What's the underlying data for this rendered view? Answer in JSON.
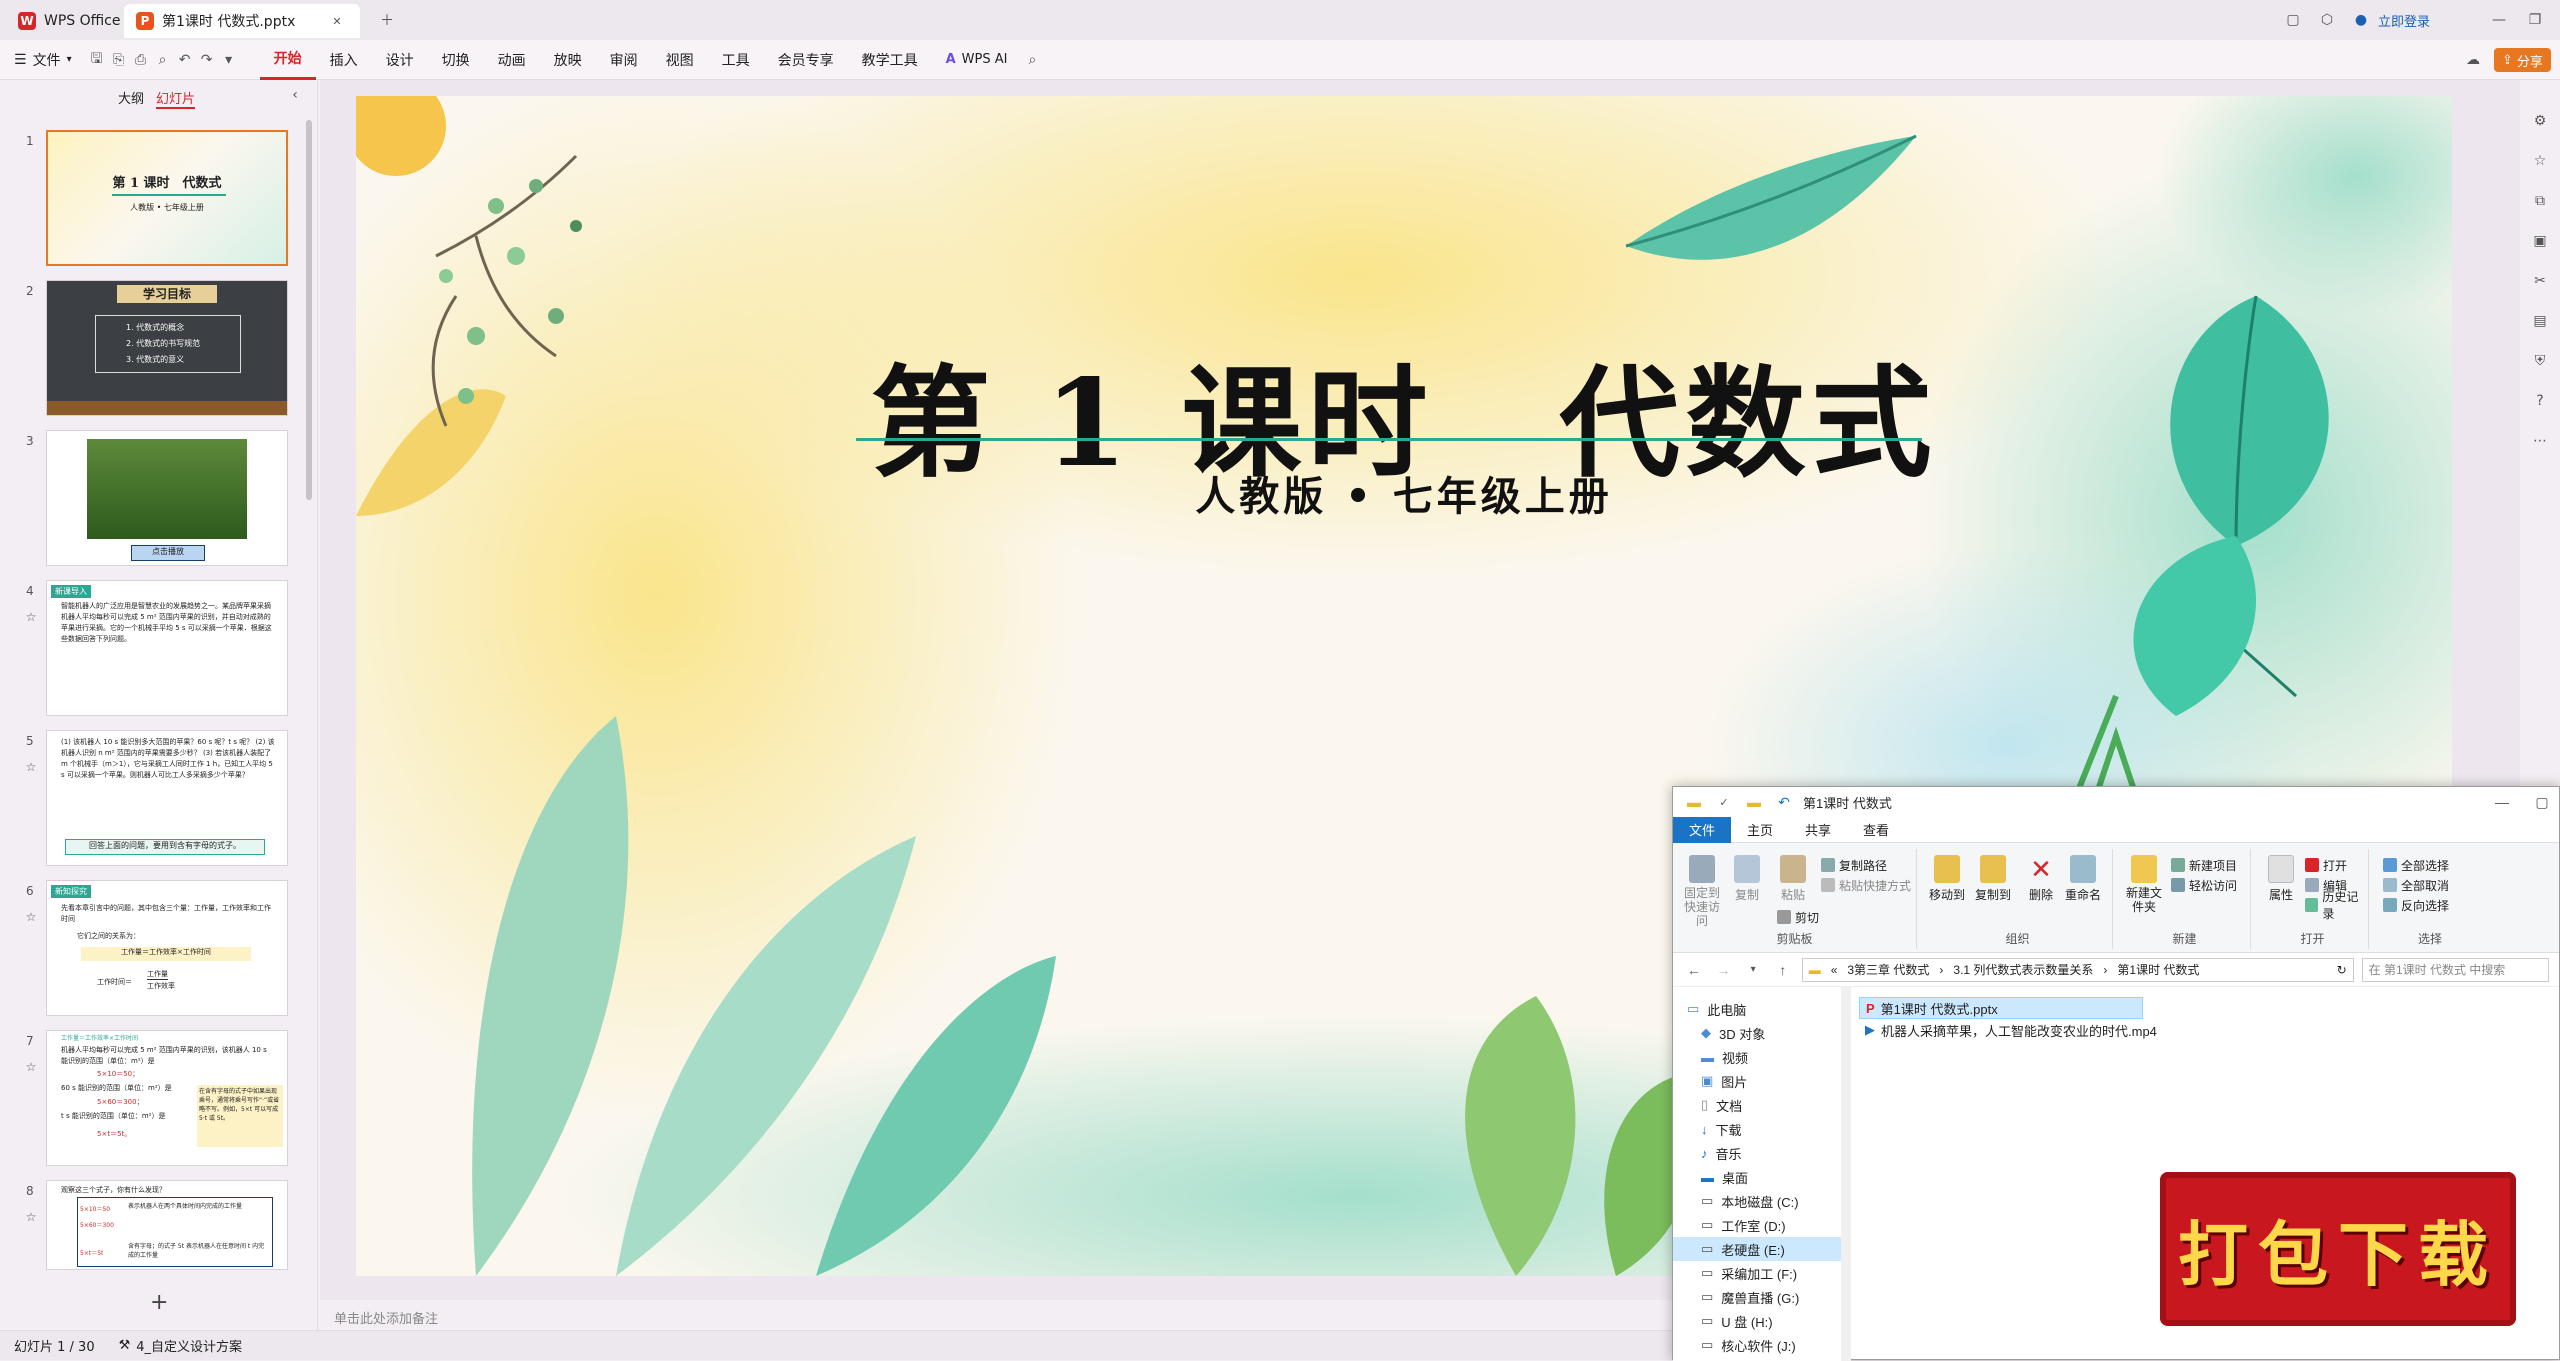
{
  "tabs": {
    "home": "WPS Office",
    "doc": "第1课时 代数式.pptx",
    "login": "立即登录"
  },
  "ribbon": {
    "file": "文件",
    "menus": [
      "开始",
      "插入",
      "设计",
      "切换",
      "动画",
      "放映",
      "审阅",
      "视图",
      "工具",
      "会员专享",
      "教学工具"
    ],
    "wps_ai": "WPS AI",
    "share": "分享"
  },
  "panel": {
    "outline": "大纲",
    "slides": "幻灯片",
    "add": "+"
  },
  "thumbs": [
    {
      "num": "1",
      "title": "第 1 课时　代数式",
      "sub": "人教版 • 七年级上册"
    },
    {
      "num": "2",
      "title": "学习目标",
      "items": [
        "1. 代数式的概念",
        "2. 代数式的书写规范",
        "3. 代数式的意义"
      ]
    },
    {
      "num": "3",
      "caption": "点击播放"
    },
    {
      "num": "4",
      "tag": "新课导入",
      "text": "智能机器人的广泛应用是智慧农业的发展趋势之一。某品牌苹果采摘机器人平均每秒可以完成 5 m² 范围内苹果的识别，并自动对成熟的苹果进行采摘。它的一个机械手平均 5 s 可以采摘一个苹果．根据这些数据回答下列问题。"
    },
    {
      "num": "5",
      "text": "(1) 该机器人 10 s 能识别多大范围的苹果？60 s 呢？t s 呢？ (2) 该机器人识别 n m² 范围内的苹果需要多少秒？ (3) 若该机器人装配了 m 个机械手（m＞1），它与采摘工人同时工作 1 h，已知工人平均 5 s 可以采摘一个苹果。则机器人可比工人多采摘多少个苹果？",
      "box": "回答上面的问题，要用到含有字母的式子。"
    },
    {
      "num": "6",
      "tag": "新知探究",
      "line1": "先看本章引言中的问题，其中包含三个量：工作量，工作效率和工作时间",
      "line2": "它们之间的关系为：",
      "f1": "工作量＝工作效率×工作时间",
      "f2a": "工作时间＝",
      "f2n": "工作量",
      "f2d": "工作效率"
    },
    {
      "num": "7",
      "head": "工作量＝工作效率×工作时间",
      "l1": "机器人平均每秒可以完成 5 m² 范围内苹果的识别，该机器人 10 s 能识别的范围（单位：m²）是",
      "a1": "5×10＝50；",
      "l2": "60 s 能识别的范围（单位：m²）是",
      "a2": "5×60＝300；",
      "l3": "t s 能识别的范围（单位：m²）是",
      "a3": "5×t＝5t。",
      "note": "在含有字母的式子中如果出现乘号，通常将乘号写作“·”或省略不写。例如，5×t 可以写成 5·t 或 5t。"
    },
    {
      "num": "8",
      "q": "观察这三个式子，你有什么发现？",
      "c1": "5×10＝50",
      "c2": "5×60＝300",
      "c3": "5×t＝5t",
      "d1": "表示机器人在两个具体时间内完成的工作量",
      "d2": "含有字母；的式子 5t 表示机器人在任意时间 t 内完成的工作量"
    }
  ],
  "slide": {
    "title": "第 1 课时　代数式",
    "subtitle": "人教版 • 七年级上册"
  },
  "notes": "单击此处添加备注",
  "status": {
    "slide": "幻灯片 1 / 30",
    "design": "4_自定义设计方案"
  },
  "explorer": {
    "title": "第1课时 代数式",
    "tabs": [
      "文件",
      "主页",
      "共享",
      "查看"
    ],
    "ribbon": {
      "pin": "固定到快速访问",
      "copy": "复制",
      "paste": "粘贴",
      "copy_path": "复制路径",
      "paste_shortcut": "粘贴快捷方式",
      "cut": "剪切",
      "move": "移动到",
      "copyto": "复制到",
      "delete": "删除",
      "rename": "重命名",
      "newfolder": "新建文件夹",
      "newitem": "新建项目",
      "easy": "轻松访问",
      "props": "属性",
      "open": "打开",
      "edit": "编辑",
      "history": "历史记录",
      "selall": "全部选择",
      "selnone": "全部取消",
      "invert": "反向选择",
      "g1": "剪贴板",
      "g2": "组织",
      "g3": "新建",
      "g4": "打开",
      "g5": "选择"
    },
    "path": [
      "3第三章 代数式",
      "3.1 列代数式表示数量关系",
      "第1课时 代数式"
    ],
    "search": "在 第1课时 代数式 中搜索",
    "nav": [
      "此电脑",
      "3D 对象",
      "视频",
      "图片",
      "文档",
      "下载",
      "音乐",
      "桌面",
      "本地磁盘 (C:)",
      "工作室 (D:)",
      "老硬盘 (E:)",
      "采编加工 (F:)",
      "魔兽直播 (G:)",
      "U 盘 (H:)",
      "核心软件 (J:)"
    ],
    "files": [
      "第1课时 代数式.pptx",
      "机器人采摘苹果，人工智能改变农业的时代.mp4"
    ]
  },
  "download": "打包下载"
}
